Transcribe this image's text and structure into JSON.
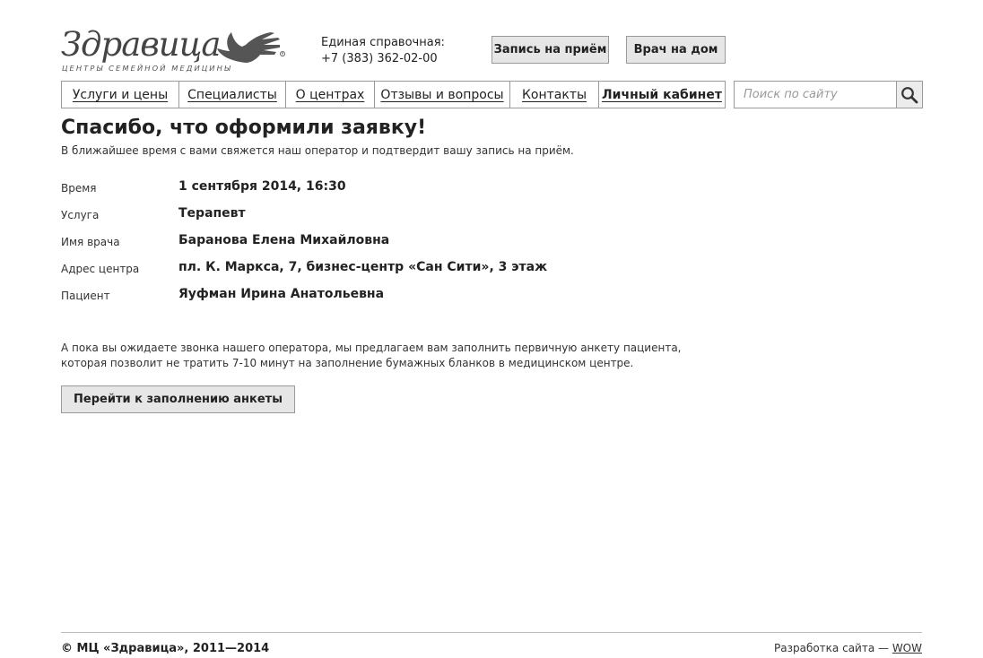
{
  "header": {
    "logo_name": "Здравица",
    "logo_tagline": "ЦЕНТРЫ СЕМЕЙНОЙ МЕДИЦИНЫ",
    "phone_label": "Единая справочная:",
    "phone_number": "+7 (383) 362-02-00",
    "appointment_button": "Запись на приём",
    "home_doctor_button": "Врач на дом"
  },
  "nav": {
    "items": [
      {
        "label": "Услуги и цены"
      },
      {
        "label": "Специалисты"
      },
      {
        "label": "О центрах"
      },
      {
        "label": "Отзывы и вопросы"
      },
      {
        "label": "Контакты"
      },
      {
        "label": "Личный кабинет"
      }
    ]
  },
  "search": {
    "placeholder": "Поиск по сайту",
    "value": ""
  },
  "main": {
    "title": "Спасибо, что оформили заявку!",
    "subtitle": "В ближайшее время с вами свяжется наш оператор и подтвердит вашу запись на приём.",
    "details": [
      {
        "label": "Время",
        "value": "1 сентября 2014, 16:30"
      },
      {
        "label": "Услуга",
        "value": "Терапевт"
      },
      {
        "label": "Имя врача",
        "value": "Баранова Елена Михайловна"
      },
      {
        "label": "Адрес центра",
        "value": "пл. К. Маркса, 7, бизнес-центр «Сан Сити», 3 этаж"
      },
      {
        "label": "Пациент",
        "value": "Яуфман Ирина Анатольевна"
      }
    ],
    "info_line1": "А пока вы ожидаете звонка нашего оператора, мы предлагаем вам заполнить первичную анкету пациента,",
    "info_line2": "которая позволит не тратить 7-10 минут на заполнение бумажных бланков в медицинском центре.",
    "cta_button": "Перейти к заполнению анкеты"
  },
  "footer": {
    "copyright": "© МЦ «Здравица», 2011—2014",
    "dev_prefix": "Разработка сайта — ",
    "dev_link": "WOW"
  },
  "colors": {
    "button_bg": "#e6e6e6",
    "border": "#9a9a9a",
    "text": "#222222"
  },
  "icons": {
    "logo_mark": "hand-bird-icon",
    "search": "magnifier-icon"
  }
}
